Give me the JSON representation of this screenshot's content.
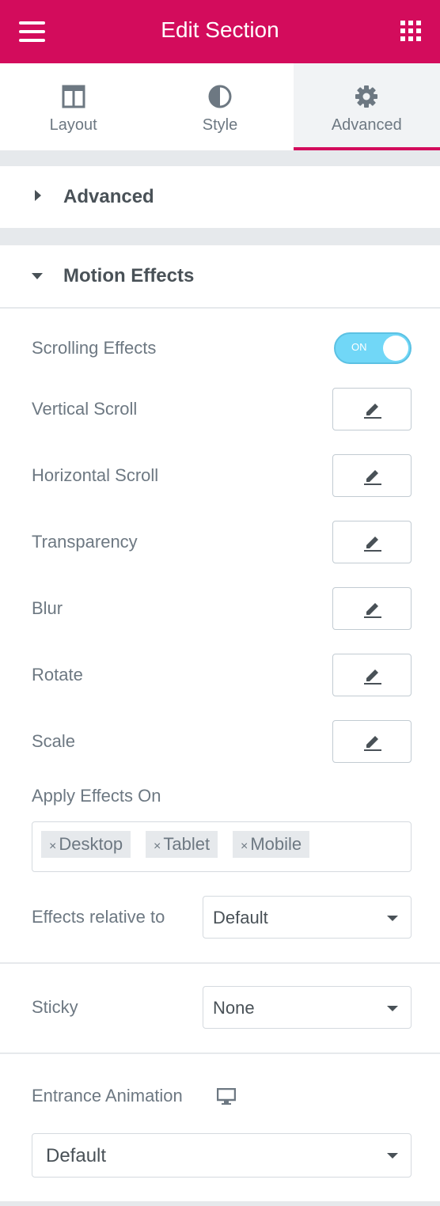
{
  "header": {
    "title": "Edit Section",
    "menu_icon": "hamburger-menu-icon",
    "apps_icon": "grid-apps-icon"
  },
  "tabs": [
    {
      "label": "Layout",
      "icon": "layout-columns-icon",
      "active": false
    },
    {
      "label": "Style",
      "icon": "half-circle-contrast-icon",
      "active": false
    },
    {
      "label": "Advanced",
      "icon": "gear-icon",
      "active": true
    }
  ],
  "sections": {
    "advanced": {
      "title": "Advanced",
      "expanded": false
    },
    "motion_effects": {
      "title": "Motion Effects",
      "expanded": true,
      "scrolling_effects": {
        "label": "Scrolling Effects",
        "toggle_text": "ON",
        "on": true
      },
      "effects": [
        {
          "label": "Vertical Scroll"
        },
        {
          "label": "Horizontal Scroll"
        },
        {
          "label": "Transparency"
        },
        {
          "label": "Blur"
        },
        {
          "label": "Rotate"
        },
        {
          "label": "Scale"
        }
      ],
      "apply_effects_on": {
        "label": "Apply Effects On",
        "chips": [
          "Desktop",
          "Tablet",
          "Mobile"
        ],
        "remove_glyph": "×"
      },
      "effects_relative_to": {
        "label": "Effects relative to",
        "value": "Default"
      },
      "sticky": {
        "label": "Sticky",
        "value": "None"
      },
      "entrance_animation": {
        "label": "Entrance Animation",
        "device_icon": "desktop-monitor-icon",
        "value": "Default"
      }
    }
  },
  "colors": {
    "brand": "#d30c5c",
    "toggle_on": "#71d7f7",
    "text": "#6d7882",
    "heading": "#495157",
    "background": "#e6e9ec"
  }
}
